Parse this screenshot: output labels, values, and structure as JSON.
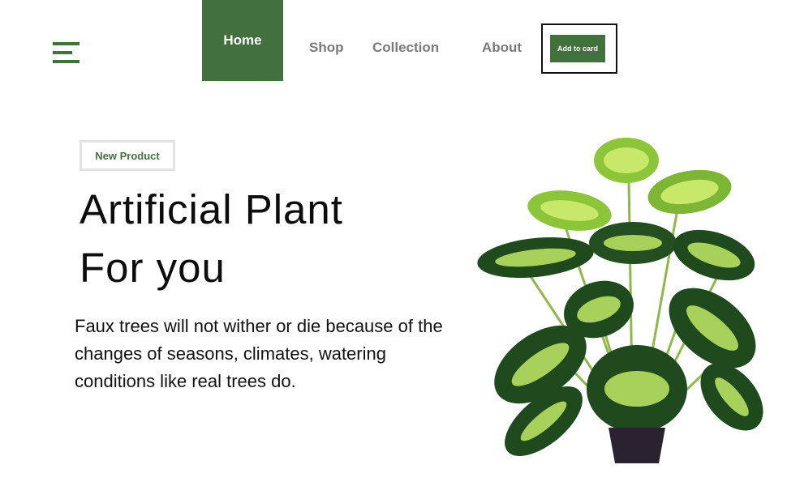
{
  "nav": {
    "menu_icon": "hamburger-menu-icon",
    "home": "Home",
    "shop": "Shop",
    "collection": "Collection",
    "about": "About",
    "cart_button": "Add to card"
  },
  "hero": {
    "badge": "New Product",
    "title_line1": "Artificial Plant",
    "title_line2": "For you",
    "description": "Faux trees will not wither or die because of the changes of seasons, climates, watering conditions like real trees do."
  },
  "colors": {
    "accent": "#42713d",
    "nav_inactive": "#7a7a7a",
    "leaf_dark": "#1f4a1d",
    "leaf_light": "#c8e86a",
    "pot": "#2a2230"
  }
}
